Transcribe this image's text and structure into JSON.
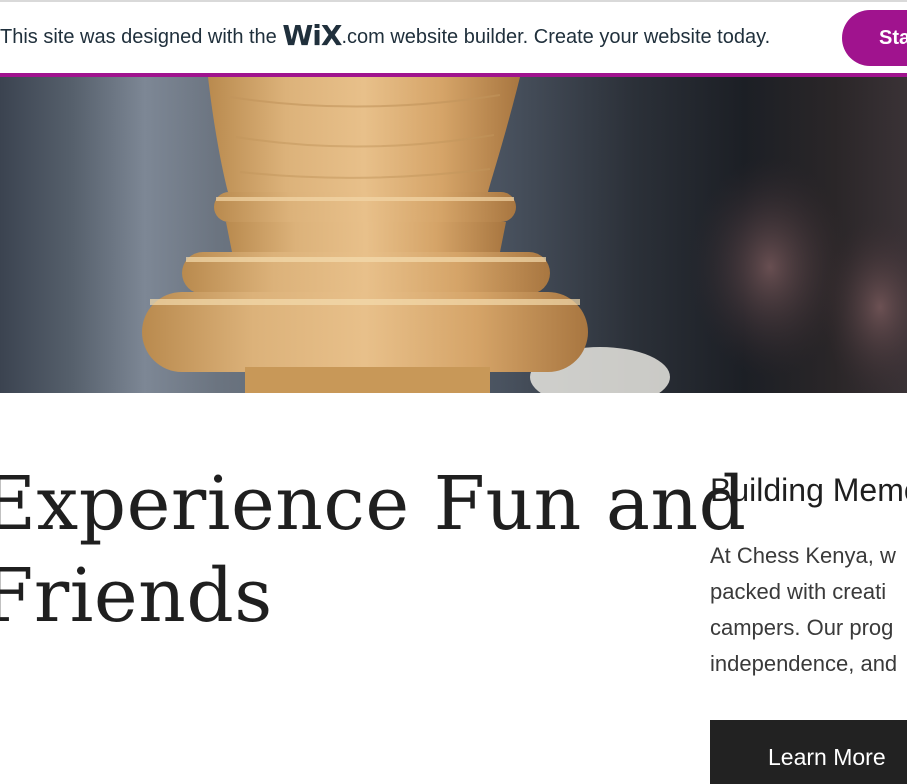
{
  "wix_banner": {
    "text_before_logo": "This site was designed with the ",
    "logo": "WiX",
    "text_after_logo": ".com website builder. Create your website today.",
    "cta_label": "Start Now",
    "accent_color": "#a0138e"
  },
  "hero": {
    "image_description": "chess-piece-closeup"
  },
  "main": {
    "headline_line1": "Experience Fun and",
    "headline_line2": "Friends",
    "subhead": "Building Memories",
    "body_lines": [
      "At Chess Kenya, w",
      "packed with creati",
      "campers. Our prog",
      "independence, and"
    ],
    "button_label": "Learn More"
  }
}
